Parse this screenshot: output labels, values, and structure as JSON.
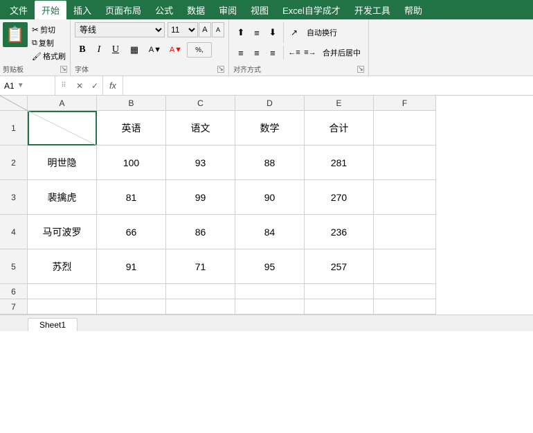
{
  "menu": {
    "items": [
      "文件",
      "开始",
      "插入",
      "页面布局",
      "公式",
      "数据",
      "审阅",
      "视图",
      "Excel自学成才",
      "开发工具",
      "帮助"
    ],
    "active": "开始"
  },
  "toolbar": {
    "clipboard": {
      "paste": "粘贴",
      "cut": "剪切",
      "copy": "复制",
      "format_painter": "格式刷",
      "label": "剪贴板"
    },
    "font": {
      "family": "等线",
      "size": "11",
      "bold": "B",
      "italic": "I",
      "underline": "U",
      "label": "字体"
    },
    "alignment": {
      "label": "对齐方式",
      "wrap": "自动换行",
      "merge": "合并后居中"
    }
  },
  "formula_bar": {
    "cell_ref": "A1",
    "cancel": "✕",
    "confirm": "✓",
    "fx": "fx",
    "formula": ""
  },
  "columns": [
    "A",
    "B",
    "C",
    "D",
    "E",
    "F"
  ],
  "rows": [
    "1",
    "2",
    "3",
    "4",
    "5",
    "6",
    "7"
  ],
  "headers": {
    "b1": "英语",
    "c1": "语文",
    "d1": "数学",
    "e1": "合计"
  },
  "data": {
    "a2": "明世隐",
    "b2": "100",
    "c2": "93",
    "d2": "88",
    "e2": "281",
    "a3": "裴擒虎",
    "b3": "81",
    "c3": "99",
    "d3": "90",
    "e3": "270",
    "a4": "马可波罗",
    "b4": "66",
    "c4": "86",
    "d4": "84",
    "e4": "236",
    "a5": "苏烈",
    "b5": "91",
    "c5": "71",
    "d5": "95",
    "e5": "257"
  },
  "sheet_tab": "Sheet1"
}
